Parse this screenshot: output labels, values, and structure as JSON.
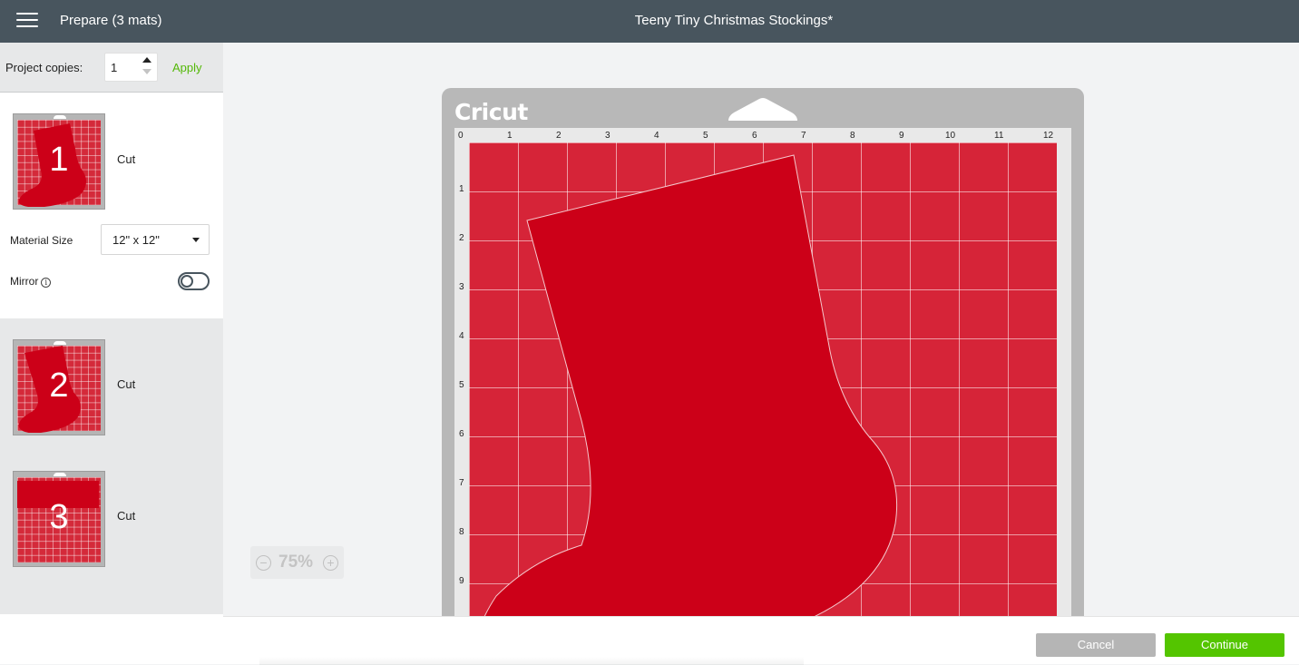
{
  "header": {
    "prepare_title": "Prepare (3 mats)",
    "project_title": "Teeny Tiny Christmas Stockings*"
  },
  "sidebar": {
    "copies_label": "Project copies:",
    "copies_value": "1",
    "apply_label": "Apply",
    "mats": [
      {
        "number": "1",
        "label": "Cut"
      },
      {
        "number": "2",
        "label": "Cut"
      },
      {
        "number": "3",
        "label": "Cut"
      }
    ],
    "material_size_label": "Material Size",
    "material_size_value": "12\" x 12\"",
    "mirror_label": "Mirror",
    "mirror_on": false
  },
  "canvas": {
    "mat_brand": "Cricut",
    "ruler_top": [
      "0",
      "1",
      "2",
      "3",
      "4",
      "5",
      "6",
      "7",
      "8",
      "9",
      "10",
      "11",
      "12"
    ],
    "ruler_left": [
      "1",
      "2",
      "3",
      "4",
      "5",
      "6",
      "7",
      "8",
      "9"
    ],
    "zoom_value": "75%",
    "mat_color": "#d62438",
    "shape_color": "#cc0018"
  },
  "footer": {
    "cancel_label": "Cancel",
    "continue_label": "Continue"
  },
  "icons": {
    "menu": "hamburger-icon",
    "info": "info-icon",
    "zoom_out": "minus-circle-icon",
    "zoom_in": "plus-circle-icon"
  }
}
